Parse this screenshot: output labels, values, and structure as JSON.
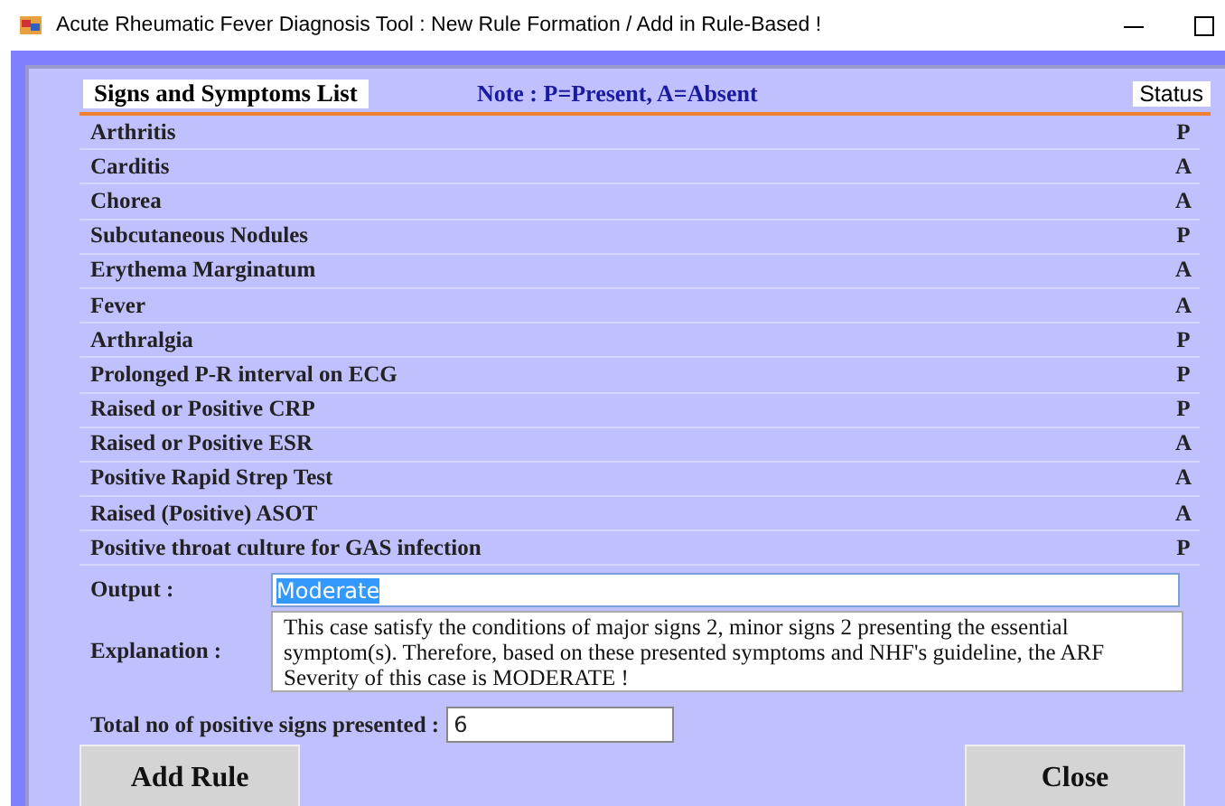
{
  "window": {
    "title": "Acute Rheumatic Fever Diagnosis Tool : New Rule Formation / Add in Rule-Based !"
  },
  "list": {
    "title": "Signs and Symptoms List",
    "note": "Note : P=Present, A=Absent",
    "status_header": "Status",
    "rows": [
      {
        "name": "Arthritis",
        "status": "P"
      },
      {
        "name": "Carditis",
        "status": "A"
      },
      {
        "name": "Chorea",
        "status": "A"
      },
      {
        "name": "Subcutaneous Nodules",
        "status": "P"
      },
      {
        "name": "Erythema Marginatum",
        "status": "A"
      },
      {
        "name": "Fever",
        "status": "A"
      },
      {
        "name": "Arthralgia",
        "status": "P"
      },
      {
        "name": "Prolonged P-R interval on ECG",
        "status": "P"
      },
      {
        "name": "Raised or Positive CRP",
        "status": "P"
      },
      {
        "name": "Raised or Positive ESR",
        "status": "A"
      },
      {
        "name": "Positive Rapid Strep Test",
        "status": "A"
      },
      {
        "name": "Raised (Positive) ASOT",
        "status": "A"
      },
      {
        "name": "Positive throat culture for GAS infection",
        "status": "P"
      }
    ]
  },
  "output": {
    "label": "Output :",
    "value": "Moderate",
    "selected": true
  },
  "explanation": {
    "label": "Explanation :",
    "value": "This case satisfy the conditions of major signs 2, minor signs 2 presenting the essential symptom(s). Therefore, based on these presented symptoms and NHF's guideline, the ARF Severity of this case is MODERATE !"
  },
  "total": {
    "label": "Total no of positive signs presented :",
    "value": "6"
  },
  "buttons": [
    {
      "label": "Add Rule"
    },
    {
      "label": "Close"
    }
  ]
}
